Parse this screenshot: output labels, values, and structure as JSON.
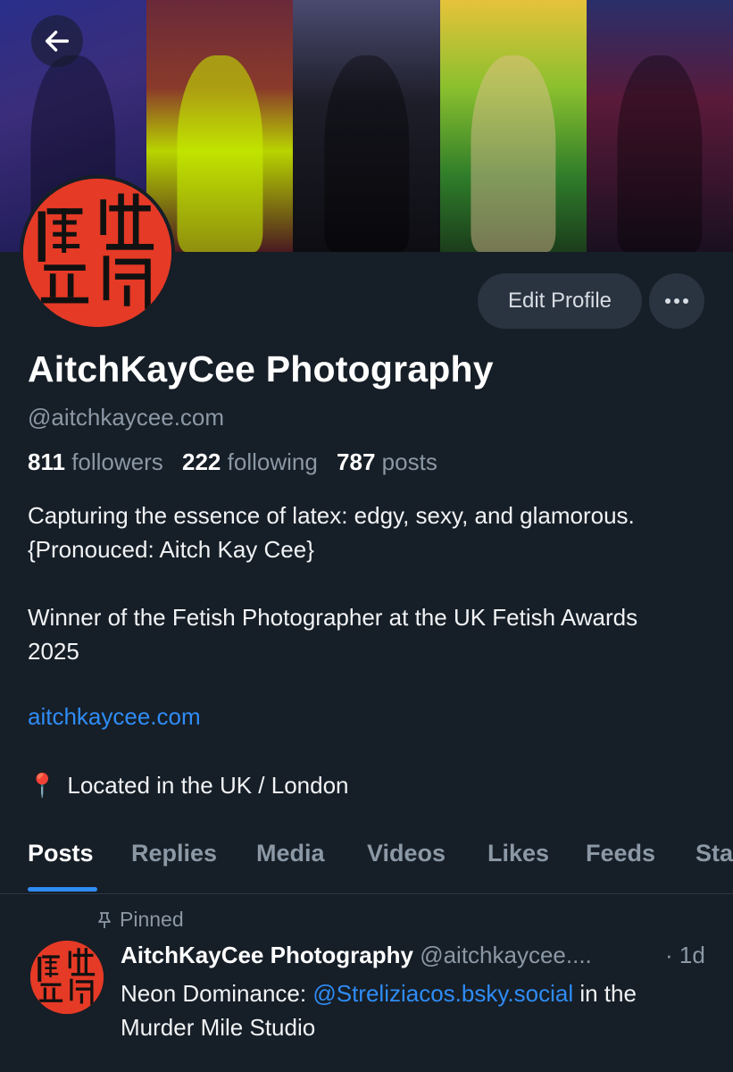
{
  "banner": {
    "panel_names": [
      "banner-photo-1",
      "banner-photo-2",
      "banner-photo-3",
      "banner-photo-4",
      "banner-photo-5"
    ]
  },
  "profile": {
    "display_name": "AitchKayCee Photography",
    "handle": "@aitchkaycee.com",
    "followers_count": "811",
    "followers_label": "followers",
    "following_count": "222",
    "following_label": "following",
    "posts_count": "787",
    "posts_label": "posts",
    "bio_line1": "Capturing the essence of latex: edgy, sexy, and glamorous. {Pronouced: Aitch Kay Cee}",
    "bio_line2": "Winner of the Fetish Photographer at the UK Fetish Awards 2025",
    "website": "aitchkaycee.com",
    "location_icon": "📍",
    "location": "Located in the UK / London"
  },
  "actions": {
    "edit_label": "Edit Profile",
    "more_icon": "ellipsis-icon"
  },
  "tabs": [
    "Posts",
    "Replies",
    "Media",
    "Videos",
    "Likes",
    "Feeds",
    "Starter Packs"
  ],
  "active_tab": "Posts",
  "pinned_post": {
    "pinned_label": "Pinned",
    "author_name": "AitchKayCee Photography",
    "author_handle": "@aitchkaycee....",
    "time": "· 1d",
    "text_before": "Neon Dominance: ",
    "mention": "@Streliziacos.bsky.social",
    "text_after": " in the Murder Mile Studio"
  },
  "colors": {
    "background": "#161e27",
    "accent": "#2f8cf5",
    "muted": "#8b98a5",
    "avatar_red": "#e53a26"
  }
}
